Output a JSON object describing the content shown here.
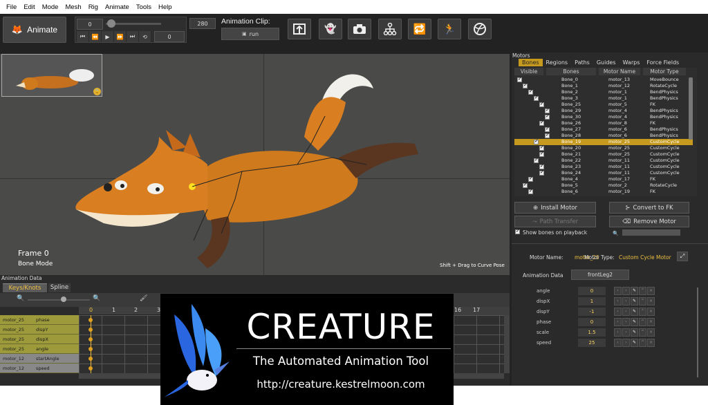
{
  "menu": [
    "File",
    "Edit",
    "Mode",
    "Mesh",
    "Rig",
    "Animate",
    "Tools",
    "Help"
  ],
  "toolbar": {
    "animate_label": "Animate",
    "frame_start": "0",
    "frame_end": "280",
    "frame_current": "0",
    "clip_title": "Animation Clip:",
    "clip_name": "run"
  },
  "viewport": {
    "frame_label": "Frame 0",
    "mode_label": "Bone Mode",
    "hint": "Shift + Drag to Curve Pose"
  },
  "panel": {
    "title": "Motors",
    "tabs": [
      "Bones",
      "Regions",
      "Paths",
      "Guides",
      "Warps",
      "Force Fields"
    ],
    "columns": [
      "Visible",
      "Bones",
      "Motor Name",
      "Motor Type"
    ],
    "rows": [
      {
        "bone": "Bone_0",
        "motor": "motor_13",
        "type": "MoveBounce",
        "indent": 0
      },
      {
        "bone": "Bone_1",
        "motor": "motor_12",
        "type": "RotateCycle",
        "indent": 1
      },
      {
        "bone": "Bone_2",
        "motor": "motor_1",
        "type": "BendPhysics",
        "indent": 2
      },
      {
        "bone": "Bone_3",
        "motor": "motor_1",
        "type": "BendPhysics",
        "indent": 3
      },
      {
        "bone": "Bone_25",
        "motor": "motor_5",
        "type": "FK",
        "indent": 4
      },
      {
        "bone": "Bone_29",
        "motor": "motor_4",
        "type": "BendPhysics",
        "indent": 5
      },
      {
        "bone": "Bone_30",
        "motor": "motor_4",
        "type": "BendPhysics",
        "indent": 5
      },
      {
        "bone": "Bone_26",
        "motor": "motor_8",
        "type": "FK",
        "indent": 4
      },
      {
        "bone": "Bone_27",
        "motor": "motor_6",
        "type": "BendPhysics",
        "indent": 5
      },
      {
        "bone": "Bone_28",
        "motor": "motor_6",
        "type": "BendPhysics",
        "indent": 5
      },
      {
        "bone": "Bone_19",
        "motor": "motor_25",
        "type": "CustomCycle",
        "indent": 3
      },
      {
        "bone": "Bone_20",
        "motor": "motor_25",
        "type": "CustomCycle",
        "indent": 4
      },
      {
        "bone": "Bone_21",
        "motor": "motor_25",
        "type": "CustomCycle",
        "indent": 4
      },
      {
        "bone": "Bone_22",
        "motor": "motor_11",
        "type": "CustomCycle",
        "indent": 3
      },
      {
        "bone": "Bone_23",
        "motor": "motor_11",
        "type": "CustomCycle",
        "indent": 4
      },
      {
        "bone": "Bone_24",
        "motor": "motor_11",
        "type": "CustomCycle",
        "indent": 4
      },
      {
        "bone": "Bone_4",
        "motor": "motor_17",
        "type": "FK",
        "indent": 2
      },
      {
        "bone": "Bone_5",
        "motor": "motor_2",
        "type": "RotateCycle",
        "indent": 1
      },
      {
        "bone": "Bone_6",
        "motor": "motor_19",
        "type": "FK",
        "indent": 2
      }
    ],
    "selected_row": 10,
    "install_motor": "Install Motor",
    "convert_fk": "Convert to FK",
    "path_transfer": "Path Transfer",
    "remove_motor": "Remove Motor",
    "show_bones": "Show bones on playback",
    "motor_name_label": "Motor Name:",
    "motor_name": "motor_25",
    "motor_type_label": "Motor Type:",
    "motor_type": "Custom Cycle Motor",
    "anim_data_label": "Animation Data",
    "anim_data_value": "frontLeg2",
    "params": [
      {
        "name": "angle",
        "value": "0"
      },
      {
        "name": "dispX",
        "value": "1"
      },
      {
        "name": "dispY",
        "value": "-1"
      },
      {
        "name": "phase",
        "value": "0"
      },
      {
        "name": "scale",
        "value": "1.5"
      },
      {
        "name": "speed",
        "value": "25"
      }
    ]
  },
  "bottom": {
    "title": "Animation Data",
    "tab_keys": "Keys/Knots",
    "tab_spline": "Spline",
    "frames": [
      "0",
      "1",
      "2",
      "3",
      "16",
      "17"
    ],
    "rows": [
      {
        "motor": "motor_25",
        "param": "phase"
      },
      {
        "motor": "motor_25",
        "param": "dispY"
      },
      {
        "motor": "motor_25",
        "param": "dispX"
      },
      {
        "motor": "motor_25",
        "param": "angle"
      },
      {
        "motor": "motor_12",
        "param": "startAngle"
      },
      {
        "motor": "motor_12",
        "param": "speed"
      }
    ]
  },
  "banner": {
    "title": "CREATURE",
    "subtitle": "The Automated Animation Tool",
    "url": "http://creature.kestrelmoon.com"
  },
  "colors": {
    "accent": "#f0b64a",
    "fur": "#d07a1e",
    "selected": "#c59a1e"
  }
}
